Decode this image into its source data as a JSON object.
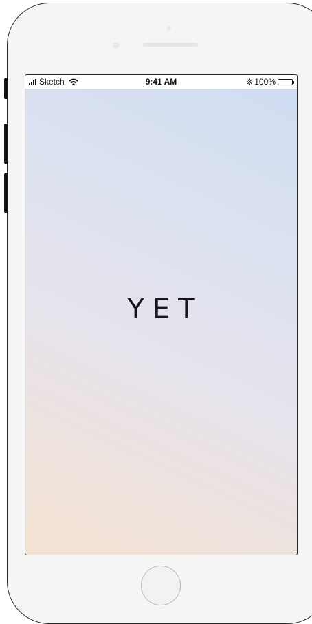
{
  "status_bar": {
    "carrier": "Sketch",
    "time": "9:41 AM",
    "battery": "100%",
    "signal_icon": "cellular-signal-icon",
    "wifi_icon": "wifi-icon",
    "bluetooth_icon": "bluetooth-icon",
    "battery_icon": "battery-icon"
  },
  "splash": {
    "logo_text": "YET"
  },
  "colors": {
    "gradient_top": "#cfdcf2",
    "gradient_bottom": "#f3e2d2",
    "logo": "#15151c"
  }
}
